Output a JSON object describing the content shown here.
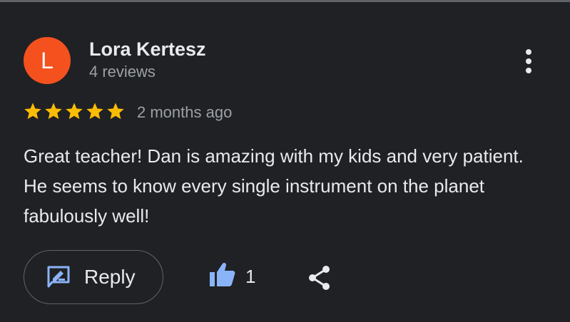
{
  "review": {
    "author": {
      "initial": "L",
      "name": "Lora Kertesz",
      "review_count": "4 reviews",
      "avatar_color": "#f4511e"
    },
    "rating": 5,
    "rating_max": 5,
    "time_ago": "2 months ago",
    "text": "Great teacher! Dan is amazing with my kids and very patient. He seems to know every single instrument on the planet fabulously well!",
    "menu_icon": "more-vert-icon"
  },
  "actions": {
    "reply_label": "Reply",
    "reply_icon": "reply-edit-icon",
    "like_icon": "thumb-up-icon",
    "like_count": "1",
    "share_icon": "share-icon"
  },
  "colors": {
    "background": "#202124",
    "star": "#fbbc04",
    "accent_blue": "#8ab4f8",
    "text_primary": "#e8eaed",
    "text_secondary": "#9aa0a6"
  }
}
